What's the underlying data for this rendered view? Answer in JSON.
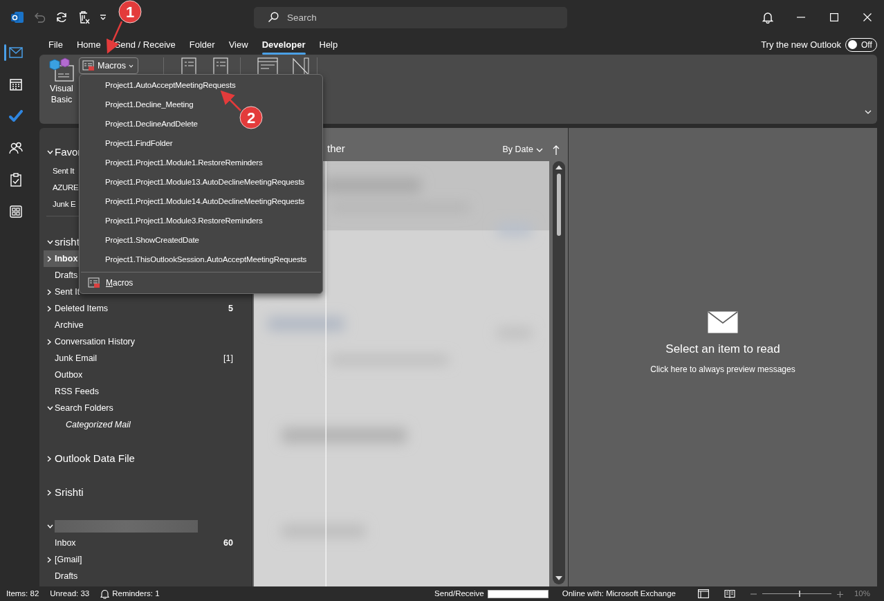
{
  "title_bar": {
    "search": {
      "placeholder": "Search"
    }
  },
  "tabs": [
    {
      "label": "File",
      "selected": false
    },
    {
      "label": "Home",
      "selected": false
    },
    {
      "label": "Send / Receive",
      "selected": false
    },
    {
      "label": "Folder",
      "selected": false
    },
    {
      "label": "View",
      "selected": false
    },
    {
      "label": "Developer",
      "selected": true
    },
    {
      "label": "Help",
      "selected": false
    }
  ],
  "new_outlook": {
    "label": "Try the new Outlook",
    "toggle": {
      "on": false,
      "label": "Off"
    }
  },
  "ribbon": {
    "visual_basic": "Visual Basic",
    "macros_button": "Macros"
  },
  "macros_menu": {
    "items": [
      {
        "label": "Project1.AutoAcceptMeetingRequests"
      },
      {
        "label": "Project1.Decline_Meeting"
      },
      {
        "label": "Project1.DeclineAndDelete"
      },
      {
        "label": "Project1.FindFolder"
      },
      {
        "label": "Project1.Project1.Module1.RestoreReminders"
      },
      {
        "label": "Project1.Project1.Module13.AutoDeclineMeetingRequests"
      },
      {
        "label": "Project1.Project1.Module14.AutoDeclineMeetingRequests"
      },
      {
        "label": "Project1.Project1.Module3.RestoreReminders"
      },
      {
        "label": "Project1.ShowCreatedDate"
      },
      {
        "label": "Project1.ThisOutlookSession.AutoAcceptMeetingRequests"
      }
    ],
    "footer": "Macros"
  },
  "nav_rail": {
    "items": [
      {
        "kind": "mail",
        "selected": true
      },
      {
        "kind": "calendar",
        "selected": false
      },
      {
        "kind": "todo",
        "selected": false
      },
      {
        "kind": "people",
        "selected": false
      },
      {
        "kind": "tasks",
        "selected": false
      },
      {
        "kind": "apps",
        "selected": false
      }
    ]
  },
  "folder_pane": {
    "sections": [
      {
        "kind": "favorites",
        "label": "Favor",
        "expanded": true,
        "items": [
          {
            "label": "Sent It",
            "selected": false
          },
          {
            "label": "AZURE",
            "selected": false
          },
          {
            "label": "Junk E",
            "selected": false
          }
        ]
      },
      {
        "kind": "account",
        "label": "srisht",
        "expanded": true,
        "items": [
          {
            "label": "Inbox",
            "expanded": false,
            "selected": true
          },
          {
            "label": "Drafts",
            "selected": false
          },
          {
            "label": "Sent It",
            "expanded": false,
            "selected": false
          },
          {
            "label": "Deleted Items",
            "expanded": false,
            "selected": false,
            "count": "5",
            "unread": true
          },
          {
            "label": "Archive",
            "selected": false
          },
          {
            "label": "Conversation History",
            "expanded": false,
            "selected": false
          },
          {
            "label": "Junk Email",
            "selected": false,
            "count": "[1]",
            "unread": false
          },
          {
            "label": "Outbox",
            "selected": false
          },
          {
            "label": "RSS Feeds",
            "selected": false
          },
          {
            "label": "Search Folders",
            "expanded": true,
            "selected": false,
            "children": [
              {
                "label": "Categorized Mail",
                "kind": "search_folder",
                "selected": false
              }
            ]
          }
        ]
      },
      {
        "kind": "account",
        "label": "Outlook Data File",
        "expanded": false
      },
      {
        "kind": "account",
        "label": "Srishti",
        "expanded": false
      },
      {
        "kind": "redacted",
        "expanded": true,
        "items": [
          {
            "label": "Inbox",
            "selected": false,
            "count": "60",
            "unread": true
          },
          {
            "label": "[Gmail]",
            "expanded": false,
            "selected": false
          },
          {
            "label": "Drafts",
            "selected": false
          }
        ]
      }
    ]
  },
  "message_list": {
    "tab": "ther",
    "sort": "By Date"
  },
  "reading_pane": {
    "title": "Select an item to read",
    "link": "Click here to always preview messages"
  },
  "status_bar": {
    "items": "Items: 82",
    "unread": "Unread: 33",
    "reminders": "Reminders: 1",
    "send_receive": {
      "label": "Send/Receive",
      "level": 1
    },
    "connection": "Online with: Microsoft Exchange",
    "zoom": {
      "level": 0.53,
      "reading": "10%"
    }
  },
  "annotations": [
    {
      "number": "1"
    },
    {
      "number": "2"
    }
  ]
}
